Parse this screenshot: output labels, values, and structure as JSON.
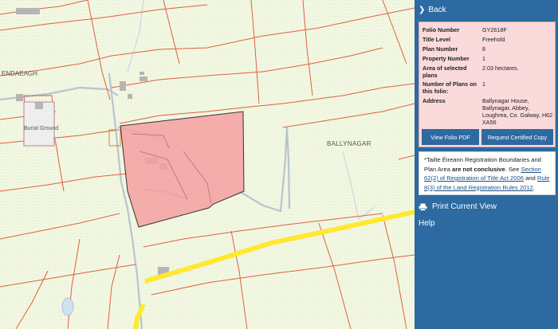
{
  "map": {
    "labels": {
      "townland_left": "ENDAEAGH",
      "burial_ground": "Burial Ground",
      "townland_right": "BALLYNAGAR"
    },
    "colors": {
      "land": "#f2f7e2",
      "boundary_red": "#e06040",
      "road_grey": "#b8c4d0",
      "highlight_fill": "#f4a0a0",
      "highlight_stroke": "#333333",
      "road_yellow": "#ffe830"
    }
  },
  "panel": {
    "back_label": "Back",
    "info": {
      "rows": [
        {
          "key": "Folio Number",
          "value": "GY2618F"
        },
        {
          "key": "Title Level",
          "value": "Freehold"
        },
        {
          "key": "Plan Number",
          "value": "8"
        },
        {
          "key": "Property Number",
          "value": "1"
        },
        {
          "key": "Area of selected plans",
          "value": "2.03 hectares."
        },
        {
          "key": "Number of Plans on this folio:",
          "value": "1"
        },
        {
          "key": "Address",
          "value": "Ballynagar House, Ballynagar, Abbey, Loughrea, Co. Galway, H62 XA56"
        }
      ],
      "view_pdf_label": "View Folio PDF",
      "request_copy_label": "Request Certified Copy"
    },
    "notice": {
      "part1": "*Tailte Éireann Registration Boundaries and Plan Area ",
      "bold": "are not conclusive",
      "part2": ". See ",
      "link1": "Section 62(2) of Registration of Title Act 2006",
      "part3": " and ",
      "link2": "Rule 8(3) of the Land Registration Rules 2012",
      "part4": "."
    },
    "print_label": "Print Current View",
    "help_label": "Help",
    "colors": {
      "panel_bg": "#2d6aa1",
      "card_bg": "#fadada",
      "card_border": "#e0a0a0"
    }
  }
}
